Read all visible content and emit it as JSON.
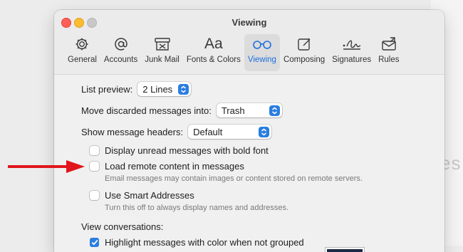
{
  "background": {
    "partial_text": "es"
  },
  "window": {
    "title": "Viewing"
  },
  "toolbar": {
    "items": [
      {
        "label": "General",
        "icon": "gear-icon"
      },
      {
        "label": "Accounts",
        "icon": "at-icon"
      },
      {
        "label": "Junk Mail",
        "icon": "junk-mail-icon"
      },
      {
        "label": "Fonts & Colors",
        "icon": "fonts-icon"
      },
      {
        "label": "Viewing",
        "icon": "glasses-icon",
        "active": true
      },
      {
        "label": "Composing",
        "icon": "compose-icon"
      },
      {
        "label": "Signatures",
        "icon": "signature-icon"
      },
      {
        "label": "Rules",
        "icon": "rules-icon"
      }
    ],
    "fonts_glyph": "Aa"
  },
  "settings": {
    "list_preview": {
      "label": "List preview:",
      "value": "2 Lines"
    },
    "discarded": {
      "label": "Move discarded messages into:",
      "value": "Trash"
    },
    "headers": {
      "label": "Show message headers:",
      "value": "Default"
    },
    "bold_unread": {
      "label": "Display unread messages with bold font",
      "checked": false
    },
    "remote_content": {
      "label": "Load remote content in messages",
      "checked": false,
      "description": "Email messages may contain images or content stored on remote servers."
    },
    "smart_addresses": {
      "label": "Use Smart Addresses",
      "checked": false,
      "description": "Turn this off to always display names and addresses."
    },
    "view_conversations": {
      "label": "View conversations:"
    },
    "highlight": {
      "label": "Highlight messages with color when not grouped",
      "checked": true
    }
  },
  "colors": {
    "accent": "#2a7de1",
    "arrow": "#e0161c",
    "highlight_color": "#1b2a44"
  }
}
